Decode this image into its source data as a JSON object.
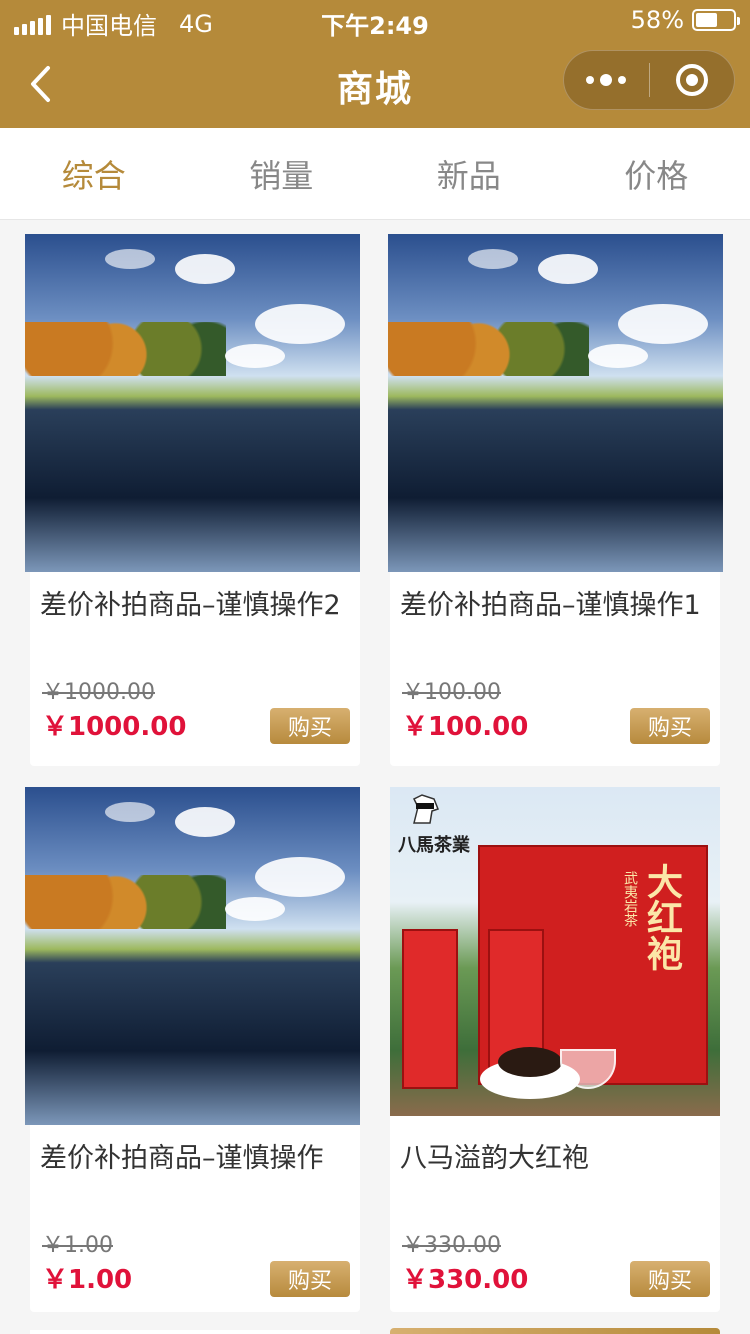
{
  "status_bar": {
    "carrier": "中国电信",
    "network": "4G",
    "time": "下午2:49",
    "battery": "58%",
    "battery_level": 0.58
  },
  "navbar": {
    "title": "商城"
  },
  "tabs": [
    {
      "label": "综合",
      "active": true
    },
    {
      "label": "销量",
      "active": false
    },
    {
      "label": "新品",
      "active": false
    },
    {
      "label": "价格",
      "active": false
    }
  ],
  "products": [
    {
      "title": "差价补拍商品–谨慎操作2",
      "old_price": "￥1000.00",
      "price": "￥1000.00",
      "buy_label": "购买",
      "image": "landscape-lake"
    },
    {
      "title": "差价补拍商品–谨慎操作1",
      "old_price": "￥100.00",
      "price": "￥100.00",
      "buy_label": "购买",
      "image": "landscape-lake"
    },
    {
      "title": "差价补拍商品–谨慎操作",
      "old_price": "￥1.00",
      "price": "￥1.00",
      "buy_label": "购买",
      "image": "landscape-lake"
    },
    {
      "title": "八马溢韵大红袍",
      "old_price": "￥330.00",
      "price": "￥330.00",
      "buy_label": "购买",
      "image": "tea-gift-box"
    }
  ],
  "tea_image_text": {
    "brand": "八馬茶業",
    "box_label": "大红袍",
    "box_subtitle": "武夷岩茶"
  },
  "colors": {
    "accent": "#b58a3a",
    "price_red": "#e0123a"
  }
}
